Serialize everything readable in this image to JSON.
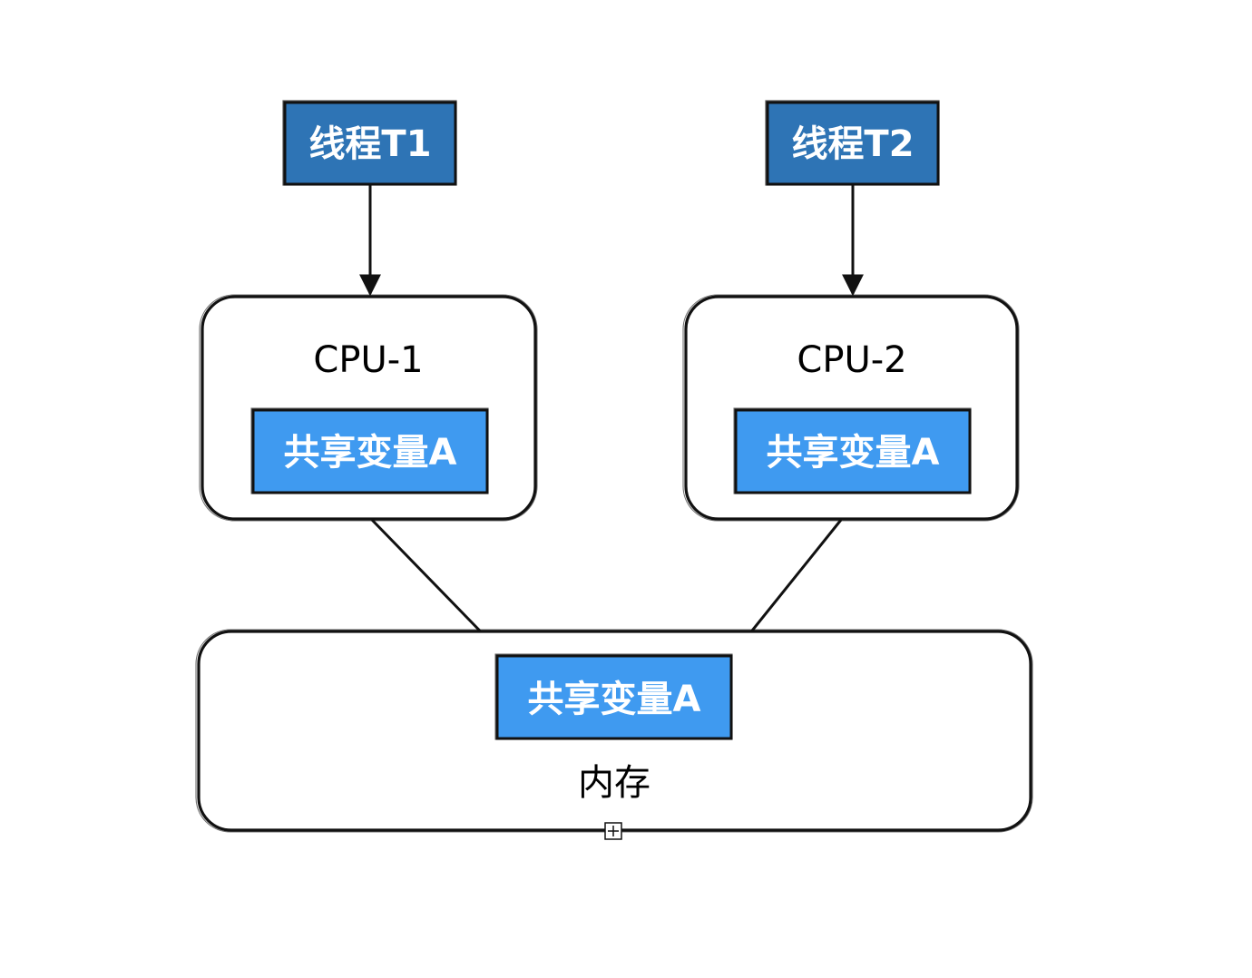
{
  "colors": {
    "thread_box_fill": "#2e74b5",
    "variable_box_fill": "#3f9af0",
    "box_border": "#111111",
    "label_light": "#ffffff",
    "label_dark": "#000000"
  },
  "threads": [
    {
      "label": "线程T1"
    },
    {
      "label": "线程T2"
    }
  ],
  "cpus": [
    {
      "label": "CPU-1",
      "variable_label": "共享变量A"
    },
    {
      "label": "CPU-2",
      "variable_label": "共享变量A"
    }
  ],
  "memory": {
    "label": "内存",
    "variable_label": "共享变量A"
  },
  "expand_handle_icon": "plus-square-icon"
}
